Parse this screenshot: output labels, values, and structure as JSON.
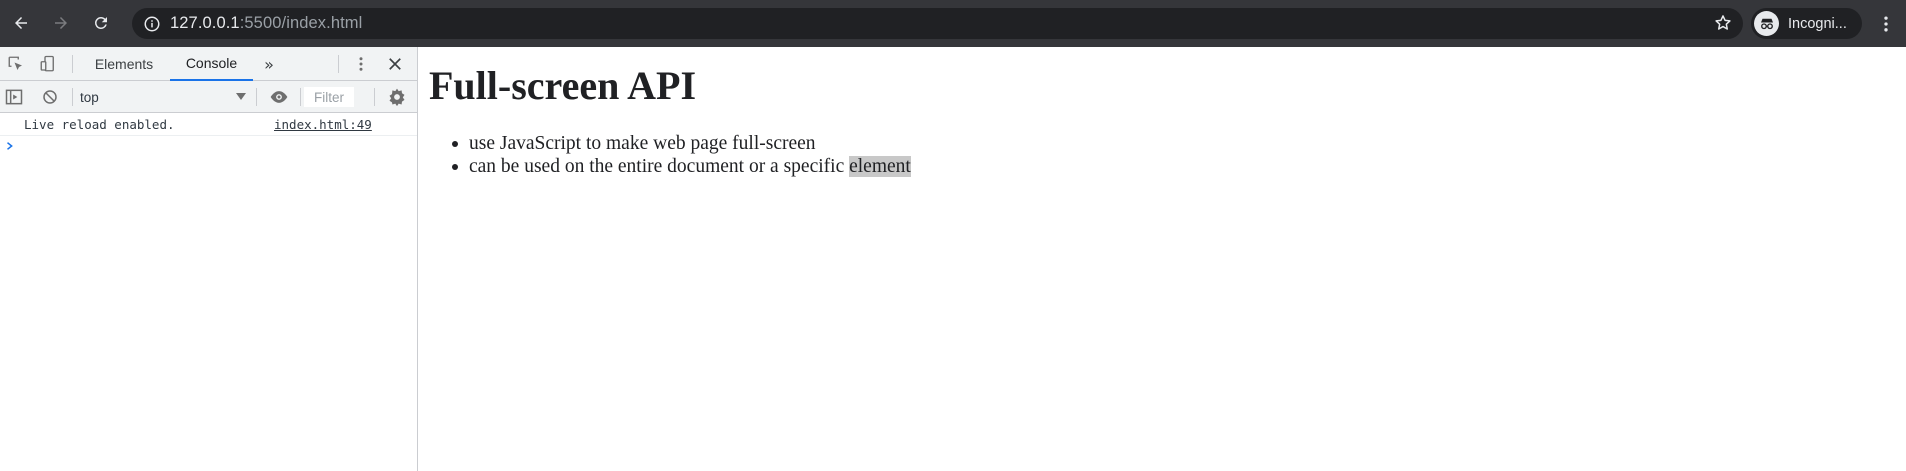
{
  "browser": {
    "url_host": "127.0.0.1",
    "url_rest": ":5500/index.html",
    "profile_label": "Incogni...",
    "icons": [
      "back-arrow-icon",
      "forward-arrow-icon",
      "reload-icon",
      "info-icon",
      "star-icon",
      "incognito-icon",
      "more-vert-icon"
    ]
  },
  "devtools": {
    "tabs": [
      "Elements",
      "Console"
    ],
    "active_tab": "Console",
    "context": "top",
    "filter_placeholder": "Filter",
    "messages": [
      {
        "text": "Live reload enabled.",
        "source": "index.html:49"
      }
    ]
  },
  "page": {
    "heading": "Full-screen API",
    "bullets": [
      "use JavaScript to make web page full-screen",
      "can be used on the entire document or a specific"
    ],
    "highlighted_word": "element"
  },
  "colors": {
    "toolbar_bg": "#35363a",
    "omnibox_bg": "#202124",
    "devtools_accent": "#1a73e8",
    "highlight": "#c8c8c8"
  }
}
